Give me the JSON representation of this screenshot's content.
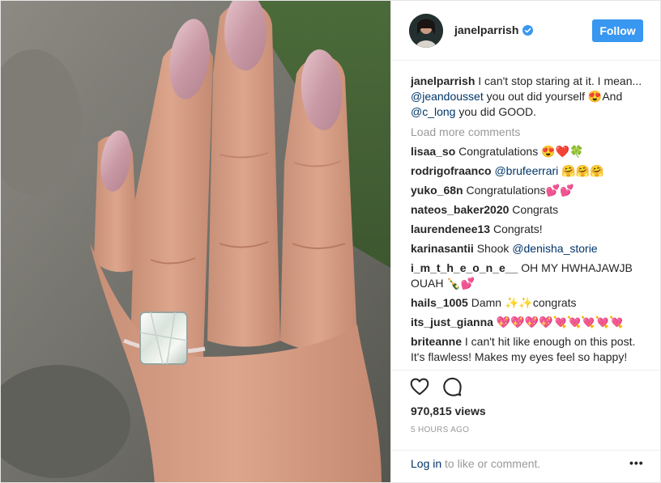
{
  "header": {
    "username": "janelparrish",
    "follow_label": "Follow"
  },
  "caption": {
    "user": "janelparrish",
    "text_1": " I can't stop staring at it. I mean... ",
    "mention_1": "@jeandousset",
    "text_2": " you out did yourself 😍And ",
    "mention_2": "@c_long",
    "text_3": " you did GOOD."
  },
  "load_more": "Load more comments",
  "comments": [
    {
      "user": "lisaa_so",
      "text": " Congratulations 😍❤️🍀",
      "mention": "",
      "after": ""
    },
    {
      "user": "rodrigofraanco",
      "text": " ",
      "mention": "@brufeerrari",
      "after": " 🤗🤗🤗"
    },
    {
      "user": "yuko_68n",
      "text": " Congratulations💕💕",
      "mention": "",
      "after": ""
    },
    {
      "user": "nateos_baker2020",
      "text": " Congrats",
      "mention": "",
      "after": ""
    },
    {
      "user": "laurendenee13",
      "text": " Congrats!",
      "mention": "",
      "after": ""
    },
    {
      "user": "karinasantii",
      "text": " Shook ",
      "mention": "@denisha_storie",
      "after": ""
    },
    {
      "user": "i_m_t_h_e_o_n_e__",
      "text": " OH MY HWHAJAWJB OUAH 🍾💕",
      "mention": "",
      "after": ""
    },
    {
      "user": "hails_1005",
      "text": " Damn ✨✨congrats",
      "mention": "",
      "after": ""
    },
    {
      "user": "its_just_gianna",
      "text": " 💖💖💖💖💘💘💘💘💘",
      "mention": "",
      "after": ""
    },
    {
      "user": "briteanne",
      "text": " I can't hit like enough on this post. It's flawless! Makes my eyes feel so happy!",
      "mention": "",
      "after": ""
    }
  ],
  "stats": {
    "views": "970,815 views",
    "time": "5 HOURS AGO"
  },
  "footer": {
    "login_link": "Log in",
    "login_rest": " to like or comment.",
    "more": "•••"
  }
}
